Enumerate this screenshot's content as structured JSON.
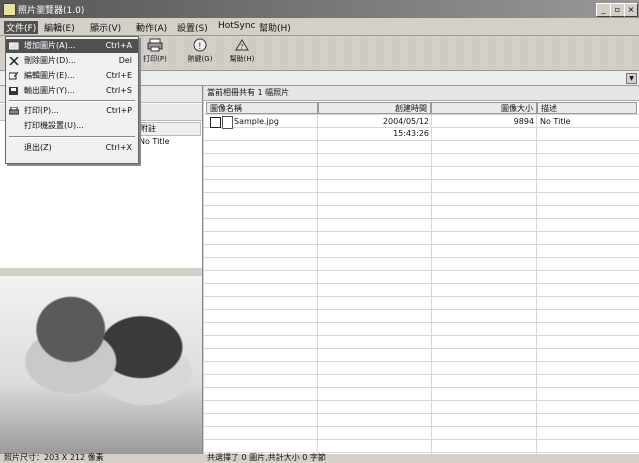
{
  "window": {
    "title": "照片瀏覽器(1.0)",
    "min_label": "_",
    "max_label": "▫",
    "close_label": "×"
  },
  "menubar": {
    "items": [
      "文件(F)",
      "編輯(E)",
      "顯示(V)",
      "動作(A)",
      "設置(S)",
      "HotSync",
      "幫助(H)"
    ]
  },
  "toolbar": {
    "buttons": [
      {
        "label": "",
        "icon": "add-photo-icon"
      },
      {
        "label": "",
        "icon": "delete-icon"
      },
      {
        "label": "",
        "icon": "edit-icon"
      },
      {
        "label": "",
        "icon": "export-icon"
      },
      {
        "label": "打印(P)",
        "icon": "printer-icon"
      },
      {
        "label": "熱鍵(G)",
        "icon": "hotkey-icon"
      },
      {
        "label": "幫助(H)",
        "icon": "help-icon"
      }
    ]
  },
  "file_menu": {
    "items": [
      {
        "label": "增加圖片(A)...",
        "shortcut": "Ctrl+A",
        "icon": "add-photo-icon",
        "highlighted": true
      },
      {
        "label": "刪除圖片(D)...",
        "shortcut": "Del",
        "icon": "delete-icon",
        "highlighted": false
      },
      {
        "label": "編輯圖片(E)...",
        "shortcut": "Ctrl+E",
        "icon": "edit-icon",
        "highlighted": false
      },
      {
        "label": "輸出圖片(Y)...",
        "shortcut": "Ctrl+S",
        "icon": "export-icon",
        "highlighted": false
      },
      {
        "label": "打印(P)...",
        "shortcut": "Ctrl+P",
        "icon": "printer-icon",
        "highlighted": false
      },
      {
        "label": "打印機設置(U)...",
        "shortcut": "",
        "icon": "",
        "highlighted": false
      },
      {
        "label": "退出(Z)",
        "shortcut": "Ctrl+X",
        "icon": "",
        "highlighted": false
      }
    ]
  },
  "left_pane": {
    "mini_header": "附註",
    "mini_cell": "No Title"
  },
  "right_pane": {
    "album_info": "當前相冊共有 1 幅照片",
    "columns": [
      "圖像名稱",
      "創建時間",
      "圖像大小",
      "描述"
    ],
    "rows": [
      {
        "name": "Sample.jpg",
        "created": "2004/05/12 15:43:26",
        "size": "9894",
        "desc": "No Title"
      }
    ]
  },
  "status": {
    "left": "照片尺寸：203 X 212 像素",
    "right": "共選擇了 0 圖片,共計大小 0 字節"
  }
}
